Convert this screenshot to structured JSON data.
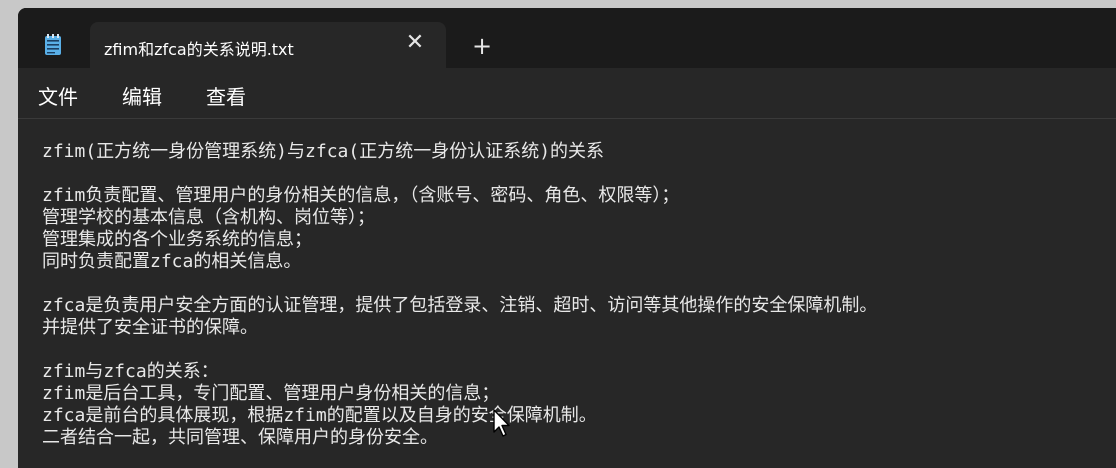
{
  "window": {
    "tab_title": "zfim和zfca的关系说明.txt",
    "close_glyph": "✕",
    "new_tab_glyph": "+",
    "app_icon": "notepad-icon"
  },
  "menu": {
    "items": [
      "文件",
      "编辑",
      "查看"
    ]
  },
  "document": {
    "lines": [
      "zfim(正方统一身份管理系统)与zfca(正方统一身份认证系统)的关系",
      "",
      "zfim负责配置、管理用户的身份相关的信息，（含账号、密码、角色、权限等）；",
      "管理学校的基本信息（含机构、岗位等）；",
      "管理集成的各个业务系统的信息；",
      "同时负责配置zfca的相关信息。",
      "",
      "zfca是负责用户安全方面的认证管理，提供了包括登录、注销、超时、访问等其他操作的安全保障机制。",
      "并提供了安全证书的保障。",
      "",
      "zfim与zfca的关系：",
      "zfim是后台工具，专门配置、管理用户身份相关的信息；",
      "zfca是前台的具体展现，根据zfim的配置以及自身的安全保障机制。",
      "二者结合一起，共同管理、保障用户的身份安全。"
    ]
  },
  "colors": {
    "background": "#272727",
    "titlebar": "#1b1b1b",
    "text": "#e8e8e8",
    "spellcheck_underline": "#d13438"
  }
}
